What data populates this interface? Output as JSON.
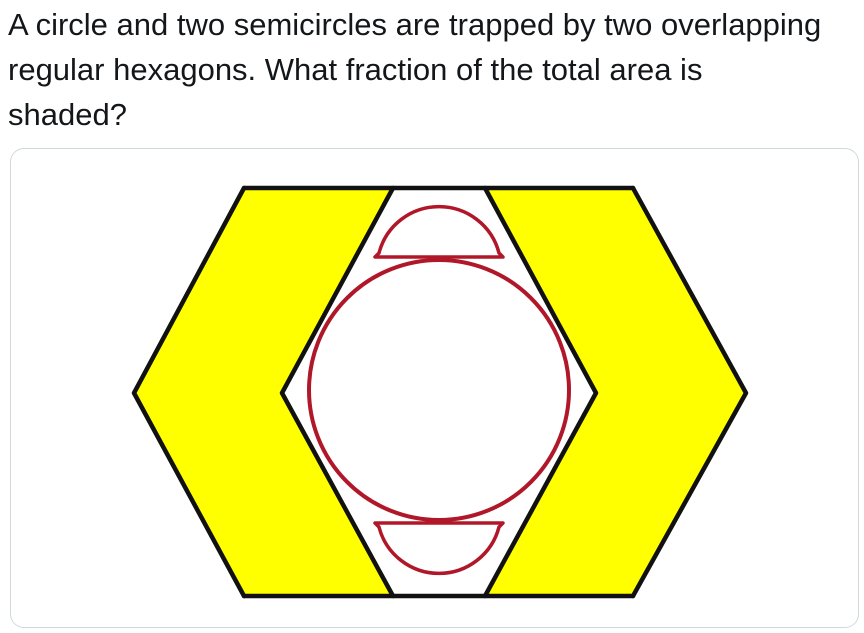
{
  "tweet": {
    "text": "A circle and two semicircles are trapped by two overlapping regular hexagons. What fraction of the total area is shaded?"
  },
  "figure": {
    "shade_color": "#ffff00",
    "outline_color": "#111111",
    "circle_color": "#b0182a",
    "background_color": "#ffffff"
  }
}
